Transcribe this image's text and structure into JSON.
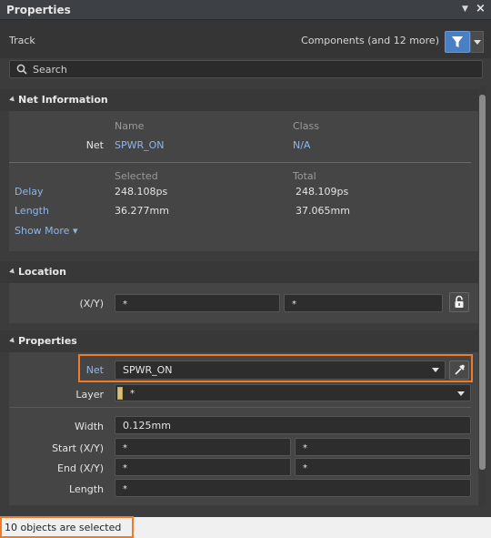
{
  "window": {
    "title": "Properties"
  },
  "header": {
    "object_kind": "Track",
    "filter_label": "Components (and 12 more)"
  },
  "search": {
    "placeholder": "Search"
  },
  "net_information": {
    "heading": "Net Information",
    "name_col": "Name",
    "class_col": "Class",
    "net_label": "Net",
    "net_name": "SPWR_ON",
    "net_class": "N/A",
    "selected_col": "Selected",
    "total_col": "Total",
    "delay_label": "Delay",
    "delay_selected": "248.108ps",
    "delay_total": "248.109ps",
    "length_label": "Length",
    "length_selected": "36.277mm",
    "length_total": "37.065mm",
    "show_more": "Show More ▾"
  },
  "location": {
    "heading": "Location",
    "xy_label": "(X/Y)",
    "x_value": "*",
    "y_value": "*"
  },
  "properties": {
    "heading": "Properties",
    "net_label": "Net",
    "net_value": "SPWR_ON",
    "layer_label": "Layer",
    "layer_value": "*",
    "width_label": "Width",
    "width_value": "0.125mm",
    "start_label": "Start (X/Y)",
    "start_x": "*",
    "start_y": "*",
    "end_label": "End (X/Y)",
    "end_x": "*",
    "end_y": "*",
    "length_label": "Length",
    "length_value": "*"
  },
  "status": {
    "text": "10 objects are selected"
  },
  "colors": {
    "accent": "#4b7fc4",
    "highlight": "#f07a28",
    "link": "#8fb6e8"
  }
}
